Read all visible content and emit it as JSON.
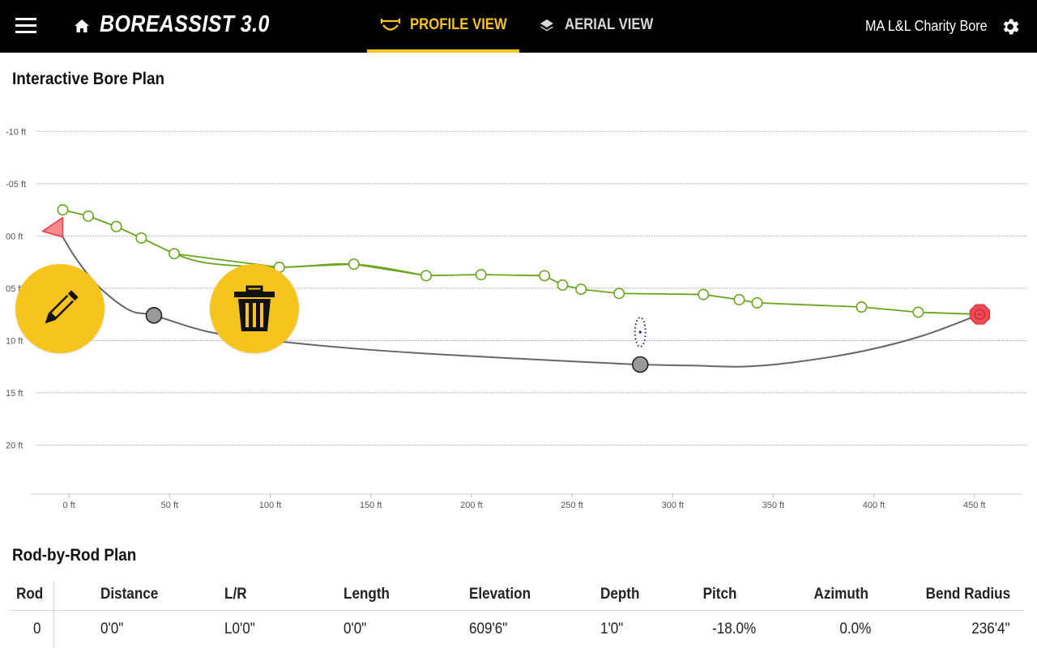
{
  "app": {
    "title": "BOREASSIST 3.0",
    "project_name": "MA L&L Charity Bore",
    "accent_color": "#f7c31d"
  },
  "tabs": [
    {
      "label": "PROFILE VIEW",
      "active": true,
      "icon": "profile-arrows-icon"
    },
    {
      "label": "AERIAL VIEW",
      "active": false,
      "icon": "layers-icon"
    }
  ],
  "sections": {
    "plan_title": "Interactive Bore Plan",
    "rod_title": "Rod-by-Rod Plan"
  },
  "chart_data": {
    "type": "line",
    "y_reversed": true,
    "y_ticks": [
      "-10 ft",
      "-05 ft",
      "00 ft",
      "05 ft",
      "10 ft",
      "15 ft",
      "20 ft"
    ],
    "y_values": [
      -10,
      -5,
      0,
      5,
      10,
      15,
      20
    ],
    "x_ticks": [
      "0 ft",
      "50 ft",
      "100 ft",
      "150 ft",
      "200 ft",
      "250 ft",
      "300 ft",
      "350 ft",
      "400 ft",
      "450 ft"
    ],
    "x_values": [
      0,
      50,
      100,
      150,
      200,
      250,
      300,
      350,
      400,
      450
    ],
    "xlim": [
      -19,
      465
    ],
    "ylim": [
      -12.5,
      24.7
    ],
    "grid": true,
    "series": [
      {
        "kind": "ground-surface",
        "color": "#6aa51e",
        "x": [
          -3.1,
          9.6,
          23.5,
          35.9,
          52.3,
          104.5,
          141.6,
          177.5,
          204.8,
          236.3,
          245.3,
          254.5,
          273.4,
          315.3,
          333.1,
          342.0,
          393.9,
          422.1,
          452.7
        ],
        "y": [
          -2.5,
          -1.9,
          -0.9,
          0.2,
          1.7,
          3.0,
          2.7,
          3.8,
          3.7,
          3.8,
          4.7,
          5.1,
          5.5,
          5.6,
          6.1,
          6.4,
          6.8,
          7.3,
          7.5
        ],
        "smooth_x": [
          52.3,
          69.0,
          104.5,
          141.6,
          177.5
        ],
        "smooth_y": [
          1.7,
          2.6,
          3.0,
          2.7,
          3.8
        ]
      },
      {
        "kind": "bore-path",
        "color": "#666666",
        "x": [
          -3.1,
          4,
          15,
          30,
          42.2,
          70,
          105,
          150,
          200,
          250,
          284,
          310,
          335,
          360,
          395,
          425,
          452.7
        ],
        "y": [
          0.1,
          2.3,
          4.9,
          7.1,
          7.6,
          9.2,
          10.1,
          10.9,
          11.5,
          12.0,
          12.3,
          12.4,
          12.5,
          12.1,
          11.0,
          9.5,
          7.5
        ]
      }
    ],
    "bore_points": [
      {
        "x": 42.2,
        "y": 7.6
      },
      {
        "x": 283.9,
        "y": 12.3
      }
    ],
    "entry_point": {
      "x": -3.1,
      "y": 0.1,
      "color": "#e8434c"
    },
    "exit_point": {
      "x": 452.7,
      "y": 7.5,
      "color": "#e8434c"
    },
    "locator": {
      "x": 283.9,
      "y": 9.2
    }
  },
  "actions": {
    "edit_icon": "pencil-icon",
    "delete_icon": "trash-icon"
  },
  "rod_table": {
    "columns": [
      "Rod",
      "Distance",
      "L/R",
      "Length",
      "Elevation",
      "Depth",
      "Pitch",
      "Azimuth",
      "Bend Radius"
    ],
    "rows": [
      [
        "0",
        "0'0\"",
        "L0'0\"",
        "0'0\"",
        "609'6\"",
        "1'0\"",
        "-18.0%",
        "0.0%",
        "236'4\""
      ]
    ]
  }
}
